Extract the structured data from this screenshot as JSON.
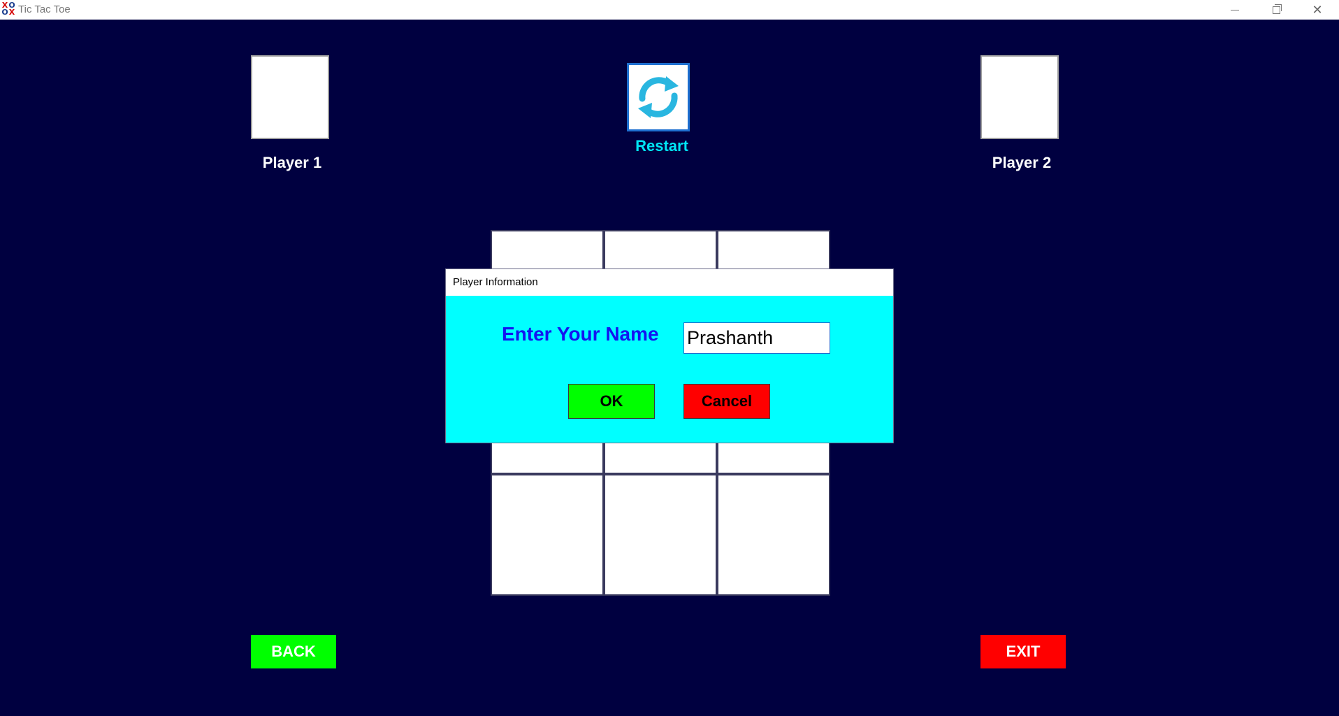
{
  "window": {
    "title": "Tic Tac Toe",
    "icon": "tictactoe-app-icon",
    "icon_glyphs": [
      "X",
      "O",
      "O",
      "X"
    ],
    "controls": {
      "minimize_icon": "minimize-icon",
      "maximize_icon": "maximize-icon",
      "close_icon": "close-icon",
      "close_glyph": "✕"
    }
  },
  "players": {
    "player1": {
      "label": "Player 1"
    },
    "player2": {
      "label": "Player 2"
    }
  },
  "restart": {
    "label": "Restart",
    "icon": "refresh-icon",
    "icon_color": "#29b6e0"
  },
  "board": {
    "cells": [
      "",
      "",
      "",
      "",
      "",
      "",
      "",
      "",
      ""
    ]
  },
  "buttons": {
    "back_label": "BACK",
    "exit_label": "EXIT"
  },
  "dialog": {
    "title": "Player Information",
    "prompt": "Enter Your Name",
    "name_value": "Prashanth",
    "ok_label": "OK",
    "cancel_label": "Cancel"
  },
  "colors": {
    "background": "#000040",
    "dialog_background": "#00ffff",
    "ok_green": "#00ff00",
    "cancel_red": "#ff0000",
    "prompt_blue": "#1414f0",
    "restart_cyan": "#00e5f5"
  }
}
